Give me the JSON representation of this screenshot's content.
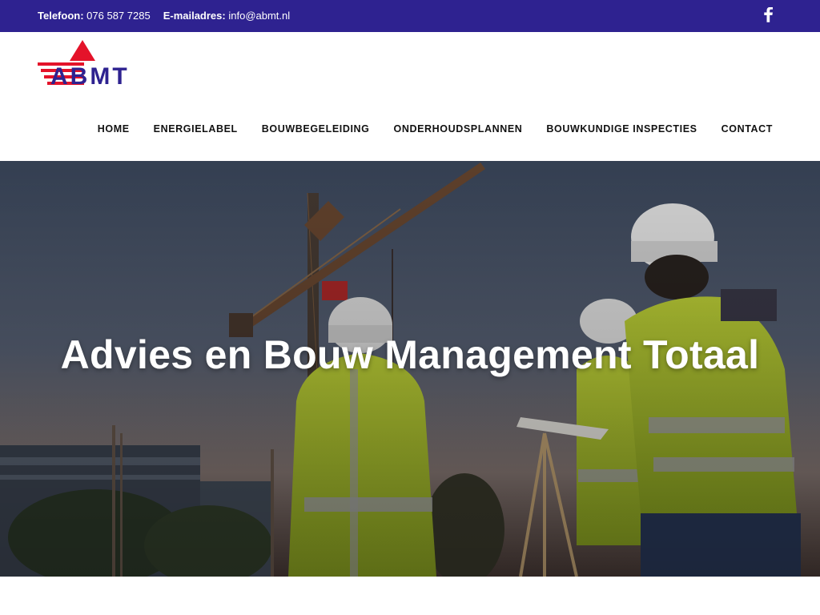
{
  "topbar": {
    "phone_label": "Telefoon:",
    "phone_value": "076 587 7285",
    "email_label": "E-mailadres:",
    "email_value": "info@abmt.nl",
    "social_icon": "facebook-icon"
  },
  "brand": {
    "logo_text": "ABMT",
    "colors": {
      "navy": "#2e2290",
      "red": "#e4132a"
    }
  },
  "nav": {
    "items": [
      "HOME",
      "ENERGIELABEL",
      "BOUWBEGELEIDING",
      "ONDERHOUDSPLANNEN",
      "BOUWKUNDIGE INSPECTIES",
      "CONTACT"
    ]
  },
  "hero": {
    "title": "Advies en Bouw Management Totaal"
  }
}
